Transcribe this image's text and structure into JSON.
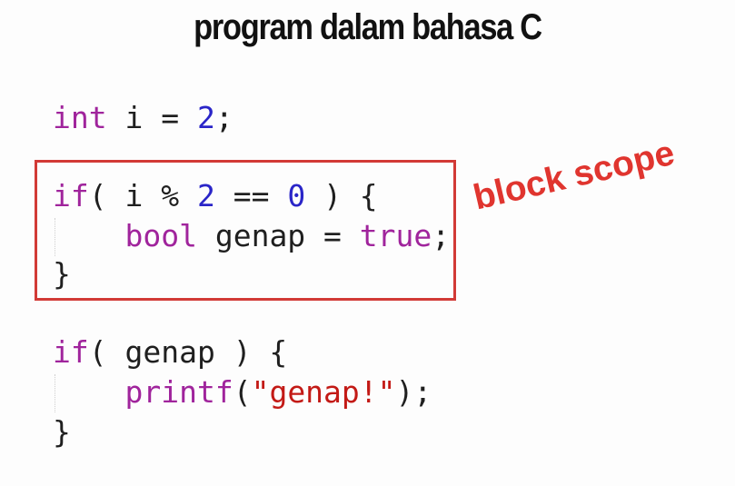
{
  "title": "program dalam bahasa C",
  "annotation": {
    "label": "block scope",
    "color": "#e0352f",
    "box_color": "#d23a36"
  },
  "code": {
    "line1": {
      "kw": "int",
      "rest_a": " i = ",
      "num": "2",
      "rest_b": ";"
    },
    "line2": {
      "kw": "if",
      "a": "( i % ",
      "n1": "2",
      "b": " == ",
      "n2": "0",
      "c": " ) {"
    },
    "line3": {
      "indent": "    ",
      "kw1": "bool",
      "a": " genap = ",
      "kw2": "true",
      "b": ";"
    },
    "line4": {
      "text": "}"
    },
    "line5": {
      "kw": "if",
      "a": "( genap ) {"
    },
    "line6": {
      "indent": "    ",
      "fn": "printf",
      "a": "(",
      "str": "\"genap!\"",
      "b": ");"
    },
    "line7": {
      "text": "}"
    }
  },
  "colors": {
    "keyword": "#a0249c",
    "number": "#2a25c8",
    "string": "#c31a16",
    "plain": "#1f1f1f"
  }
}
